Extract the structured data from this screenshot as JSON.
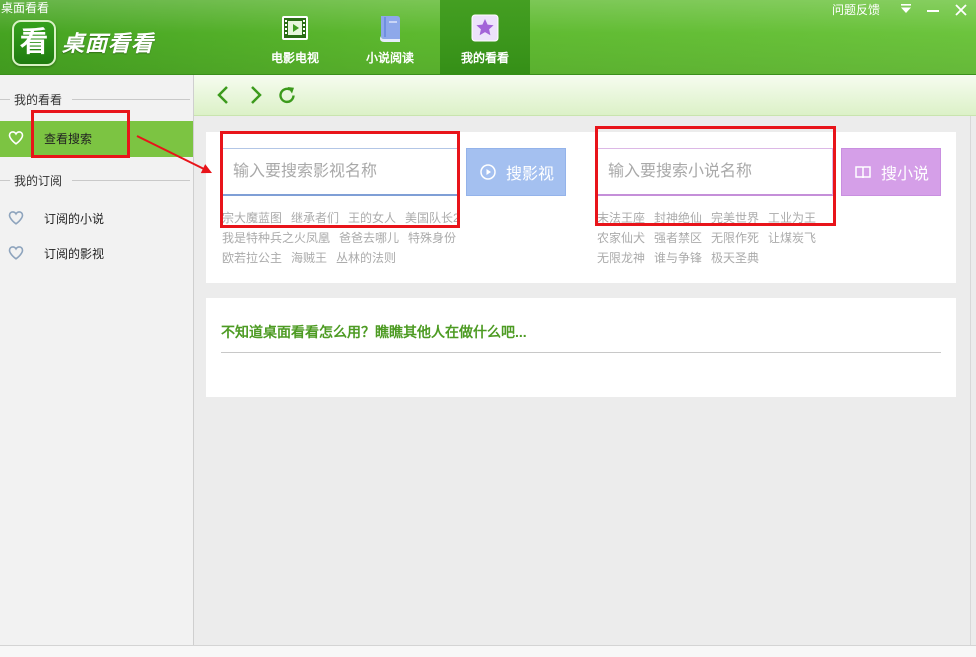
{
  "window": {
    "title": "桌面看看",
    "feedback": "问题反馈"
  },
  "logo": {
    "mark": "看",
    "text": "桌面看看"
  },
  "tabs": [
    {
      "label": "电影电视",
      "icon": "film-icon",
      "active": false
    },
    {
      "label": "小说阅读",
      "icon": "book-icon",
      "active": false
    },
    {
      "label": "我的看看",
      "icon": "star-icon",
      "active": true
    }
  ],
  "window_controls": [
    "menu-dropdown-icon",
    "minimize-icon",
    "close-icon"
  ],
  "sidebar": {
    "groups": [
      {
        "title": "我的看看",
        "items": [
          {
            "label": "查看搜索",
            "icon": "heart-icon",
            "selected": true
          }
        ]
      },
      {
        "title": "我的订阅",
        "items": [
          {
            "label": "订阅的小说",
            "icon": "heart-icon",
            "selected": false
          },
          {
            "label": "订阅的影视",
            "icon": "heart-icon",
            "selected": false
          }
        ]
      }
    ]
  },
  "toolbar": [
    "back-icon",
    "forward-icon",
    "refresh-icon"
  ],
  "video_search": {
    "placeholder": "输入要搜索影视名称",
    "button": "搜影视",
    "button_icon": "play-circle-icon",
    "hot": [
      [
        "宗大魔蓝图",
        "继承者们",
        "王的女人",
        "美国队长2"
      ],
      [
        "我是特种兵之火凤凰",
        "爸爸去哪儿",
        "特殊身份"
      ],
      [
        "欧若拉公主",
        "海贼王",
        "丛林的法则"
      ]
    ]
  },
  "novel_search": {
    "placeholder": "输入要搜索小说名称",
    "button": "搜小说",
    "button_icon": "open-book-icon",
    "hot": [
      [
        "末法王座",
        "封神绝仙",
        "完美世界",
        "工业为王"
      ],
      [
        "农家仙犬",
        "强者禁区",
        "无限作死",
        "让煤炭飞"
      ],
      [
        "无限龙神",
        "谁与争锋",
        "极天圣典"
      ]
    ]
  },
  "help": {
    "text": "不知道桌面看看怎么用？瞧瞧其他人在做什么吧..."
  },
  "colors": {
    "brand_green": "#5cb82e",
    "selected_item": "#7cc442",
    "video_button": "#a4c0f0",
    "novel_button": "#d59fe8",
    "help_text": "#4d9b23",
    "annotation": "#e8141a"
  }
}
